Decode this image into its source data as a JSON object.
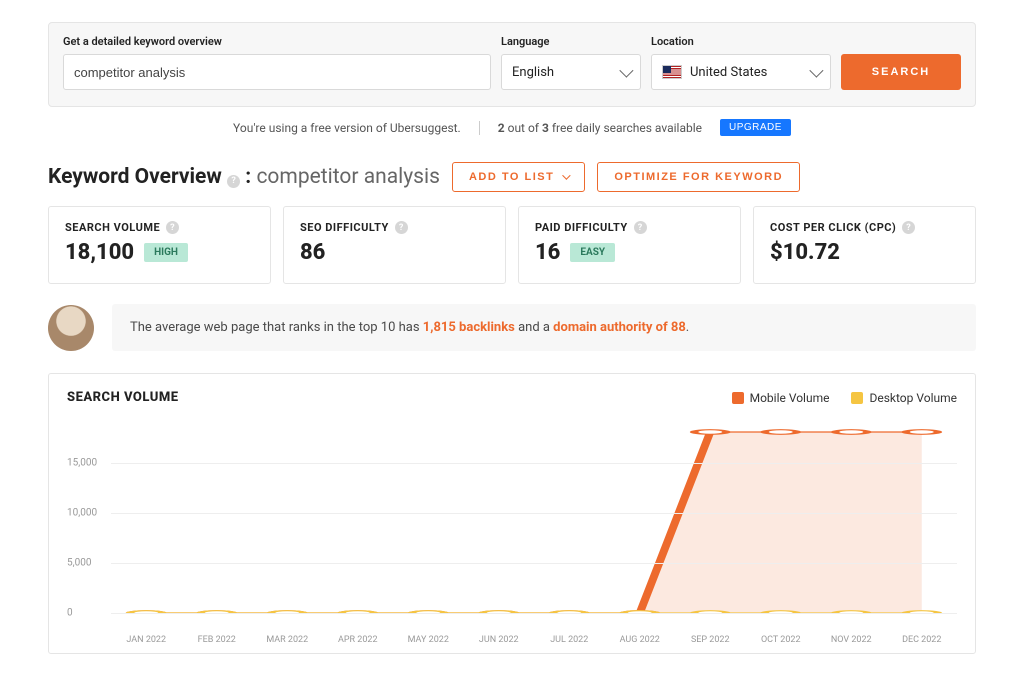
{
  "search": {
    "label": "Get a detailed keyword overview",
    "value": "competitor analysis",
    "language_label": "Language",
    "language_value": "English",
    "location_label": "Location",
    "location_value": "United States",
    "button": "SEARCH"
  },
  "notice": {
    "prefix": "You're using a free version of Ubersuggest.",
    "count_used": "2",
    "mid": " out of ",
    "count_total": "3",
    "suffix": " free daily searches available",
    "upgrade": "UPGRADE"
  },
  "overview": {
    "title": "Keyword Overview",
    "keyword": "competitor analysis",
    "add_to_list": "ADD TO LIST",
    "optimize": "OPTIMIZE FOR KEYWORD",
    "cards": [
      {
        "label": "SEARCH VOLUME",
        "value": "18,100",
        "pill": "HIGH"
      },
      {
        "label": "SEO DIFFICULTY",
        "value": "86",
        "pill": ""
      },
      {
        "label": "PAID DIFFICULTY",
        "value": "16",
        "pill": "EASY"
      },
      {
        "label": "COST PER CLICK (CPC)",
        "value": "$10.72",
        "pill": ""
      }
    ],
    "tip_pre": "The average web page that ranks in the top 10 has ",
    "tip_backlinks": "1,815 backlinks",
    "tip_mid": " and a ",
    "tip_da": "domain authority of 88",
    "tip_post": "."
  },
  "chart_data": {
    "type": "area",
    "title": "SEARCH VOLUME",
    "legend": [
      {
        "name": "Mobile Volume",
        "color": "#ed6a2d"
      },
      {
        "name": "Desktop Volume",
        "color": "#f5c542"
      }
    ],
    "categories": [
      "JAN 2022",
      "FEB 2022",
      "MAR 2022",
      "APR 2022",
      "MAY 2022",
      "JUN 2022",
      "JUL 2022",
      "AUG 2022",
      "SEP 2022",
      "OCT 2022",
      "NOV 2022",
      "DEC 2022"
    ],
    "yticks": [
      0,
      5000,
      10000,
      15000
    ],
    "ytick_labels": [
      "0",
      "5,000",
      "10,000",
      "15,000"
    ],
    "series": [
      {
        "name": "Mobile Volume",
        "values": [
          0,
          0,
          0,
          0,
          0,
          0,
          0,
          0,
          18100,
          18100,
          18100,
          18100
        ]
      },
      {
        "name": "Desktop Volume",
        "values": [
          0,
          0,
          0,
          0,
          0,
          0,
          0,
          0,
          0,
          0,
          0,
          0
        ]
      }
    ],
    "ylim": [
      0,
      20000
    ]
  }
}
